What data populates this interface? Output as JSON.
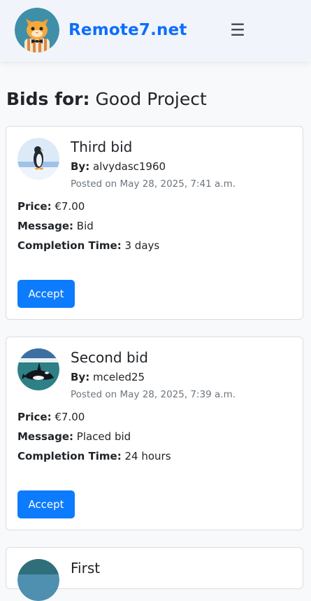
{
  "header": {
    "brand": "Remote7.net",
    "menu_icon": "hamburger-menu-icon",
    "menu_glyph": "☰",
    "brand_color": "#0d6efd"
  },
  "page": {
    "title_label": "Bids for:",
    "project_name": "Good Project"
  },
  "bids": [
    {
      "title": "Third bid",
      "by_label": "By:",
      "user": "alvydasc1960",
      "posted": "Posted on May 28, 2025, 7:41 a.m.",
      "price_label": "Price:",
      "price": "€7.00",
      "message_label": "Message:",
      "message": "Bid",
      "completion_label": "Completion Time:",
      "completion": "3 days",
      "accept_label": "Accept",
      "avatar_icon": "penguin-avatar"
    },
    {
      "title": "Second bid",
      "by_label": "By:",
      "user": "mceled25",
      "posted": "Posted on May 28, 2025, 7:39 a.m.",
      "price_label": "Price:",
      "price": "€7.00",
      "message_label": "Message:",
      "message": "Placed bid",
      "completion_label": "Completion Time:",
      "completion": "24 hours",
      "accept_label": "Accept",
      "avatar_icon": "orca-avatar"
    },
    {
      "title": "First",
      "avatar_icon": "landscape-avatar"
    }
  ],
  "colors": {
    "accept_button": "#0d7bfd",
    "muted_text": "#6c757d",
    "card_border": "#d9dde1"
  }
}
